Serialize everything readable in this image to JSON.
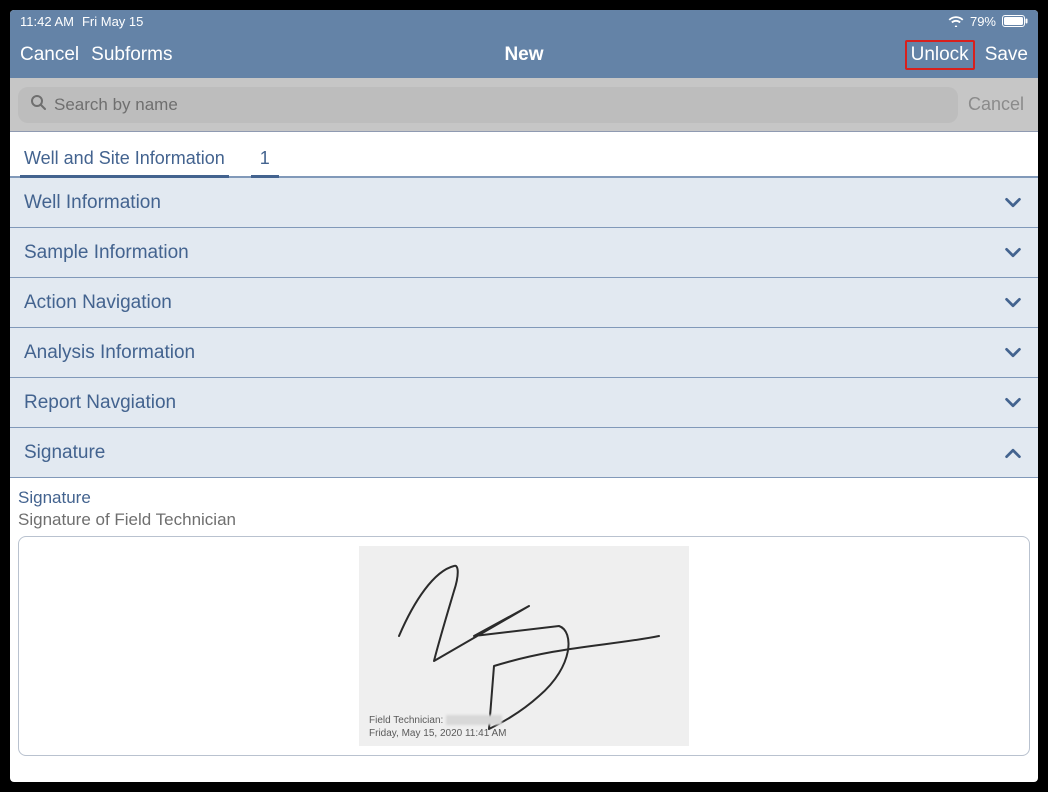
{
  "status": {
    "time": "11:42 AM",
    "date": "Fri May 15",
    "battery_pct": "79%"
  },
  "nav": {
    "cancel": "Cancel",
    "subforms": "Subforms",
    "title": "New",
    "unlock": "Unlock",
    "save": "Save"
  },
  "search": {
    "placeholder": "Search by name",
    "cancel": "Cancel"
  },
  "tabs": {
    "main": "Well and Site Information",
    "page": "1"
  },
  "sections": [
    {
      "label": "Well Information",
      "expanded": false
    },
    {
      "label": "Sample Information",
      "expanded": false
    },
    {
      "label": "Action Navigation",
      "expanded": false
    },
    {
      "label": "Analysis Information",
      "expanded": false
    },
    {
      "label": "Report Navgiation",
      "expanded": false
    },
    {
      "label": "Signature",
      "expanded": true
    }
  ],
  "signature": {
    "heading": "Signature",
    "subheading": "Signature of Field Technician",
    "meta_role": "Field Technician:",
    "meta_date": "Friday, May 15, 2020 11:41 AM"
  },
  "colors": {
    "header_bg": "#6483a7",
    "section_bg": "#e2e9f1",
    "accent_text": "#43638f",
    "highlight_border": "#d8201d"
  }
}
